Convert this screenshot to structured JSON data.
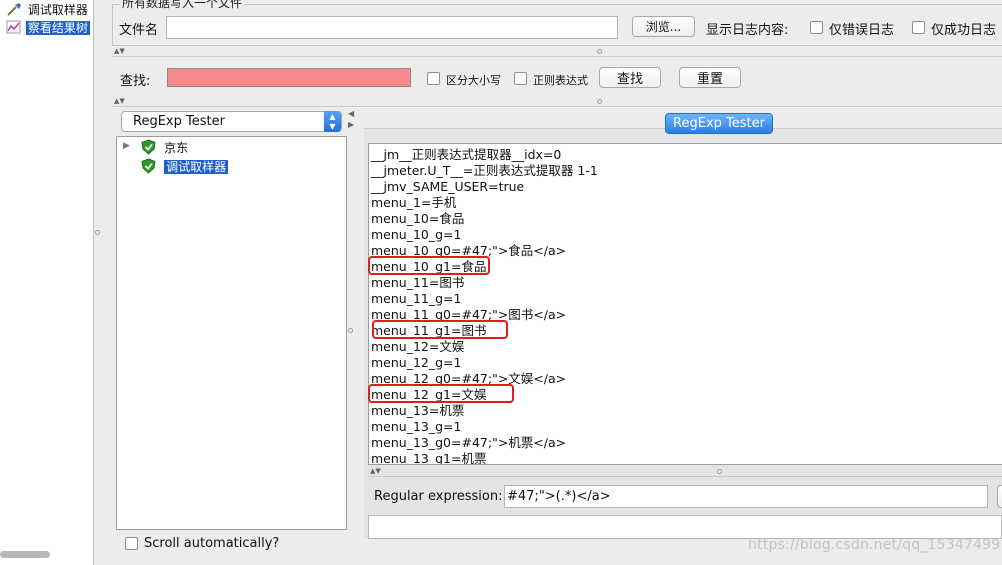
{
  "tree": {
    "items": [
      {
        "label": "调试取样器",
        "icon": "dropper-icon",
        "selected": false
      },
      {
        "label": "察看结果树",
        "icon": "chart-icon",
        "selected": true
      }
    ]
  },
  "file_group": {
    "title": "所有数据写入一个文件",
    "filename_label": "文件名",
    "filename_value": "",
    "browse_button": "浏览...",
    "log_label": "显示日志内容:",
    "errors_only": "仅错误日志",
    "success_only": "仅成功日志"
  },
  "search": {
    "label": "查找:",
    "value": "",
    "input_color": "#f58a8a",
    "case_sensitive": "区分大小写",
    "regex": "正则表达式",
    "find_button": "查找",
    "reset_button": "重置"
  },
  "renderer": {
    "selected": "RegExp Tester"
  },
  "samples": [
    {
      "label": "京东",
      "icon": "shield-check-icon",
      "selected": false,
      "expandable": true
    },
    {
      "label": "调试取样器",
      "icon": "shield-check-icon",
      "selected": true,
      "expandable": false
    }
  ],
  "scroll_auto": "Scroll automatically?",
  "tester": {
    "header": "RegExp Tester",
    "lines": [
      "__jm__正则表达式提取器__idx=0",
      "__jmeter.U_T__=正则表达式提取器 1-1",
      "__jmv_SAME_USER=true",
      "menu_1=手机",
      "menu_10=食品",
      "menu_10_g=1",
      "menu_10_g0=#47;\">食品</a>",
      "menu_10_g1=食品",
      "menu_11=图书",
      "menu_11_g=1",
      "menu_11_g0=#47;\">图书</a>",
      "menu_11_g1=图书",
      "menu_12=文娱",
      "menu_12_g=1",
      "menu_12_g0=#47;\">文娱</a>",
      "menu_12_g1=文娱",
      "menu_13=机票",
      "menu_13_g=1",
      "menu_13_g0=#47;\">机票</a>",
      "menu_13_g1=机票"
    ],
    "highlighted": [
      7,
      11,
      15
    ],
    "highlight_color": "#e31b1b",
    "regex_label": "Regular expression:",
    "regex_value": "#47;\">(.*)</a>"
  },
  "watermark": "https://blog.csdn.net/qq_15347499"
}
